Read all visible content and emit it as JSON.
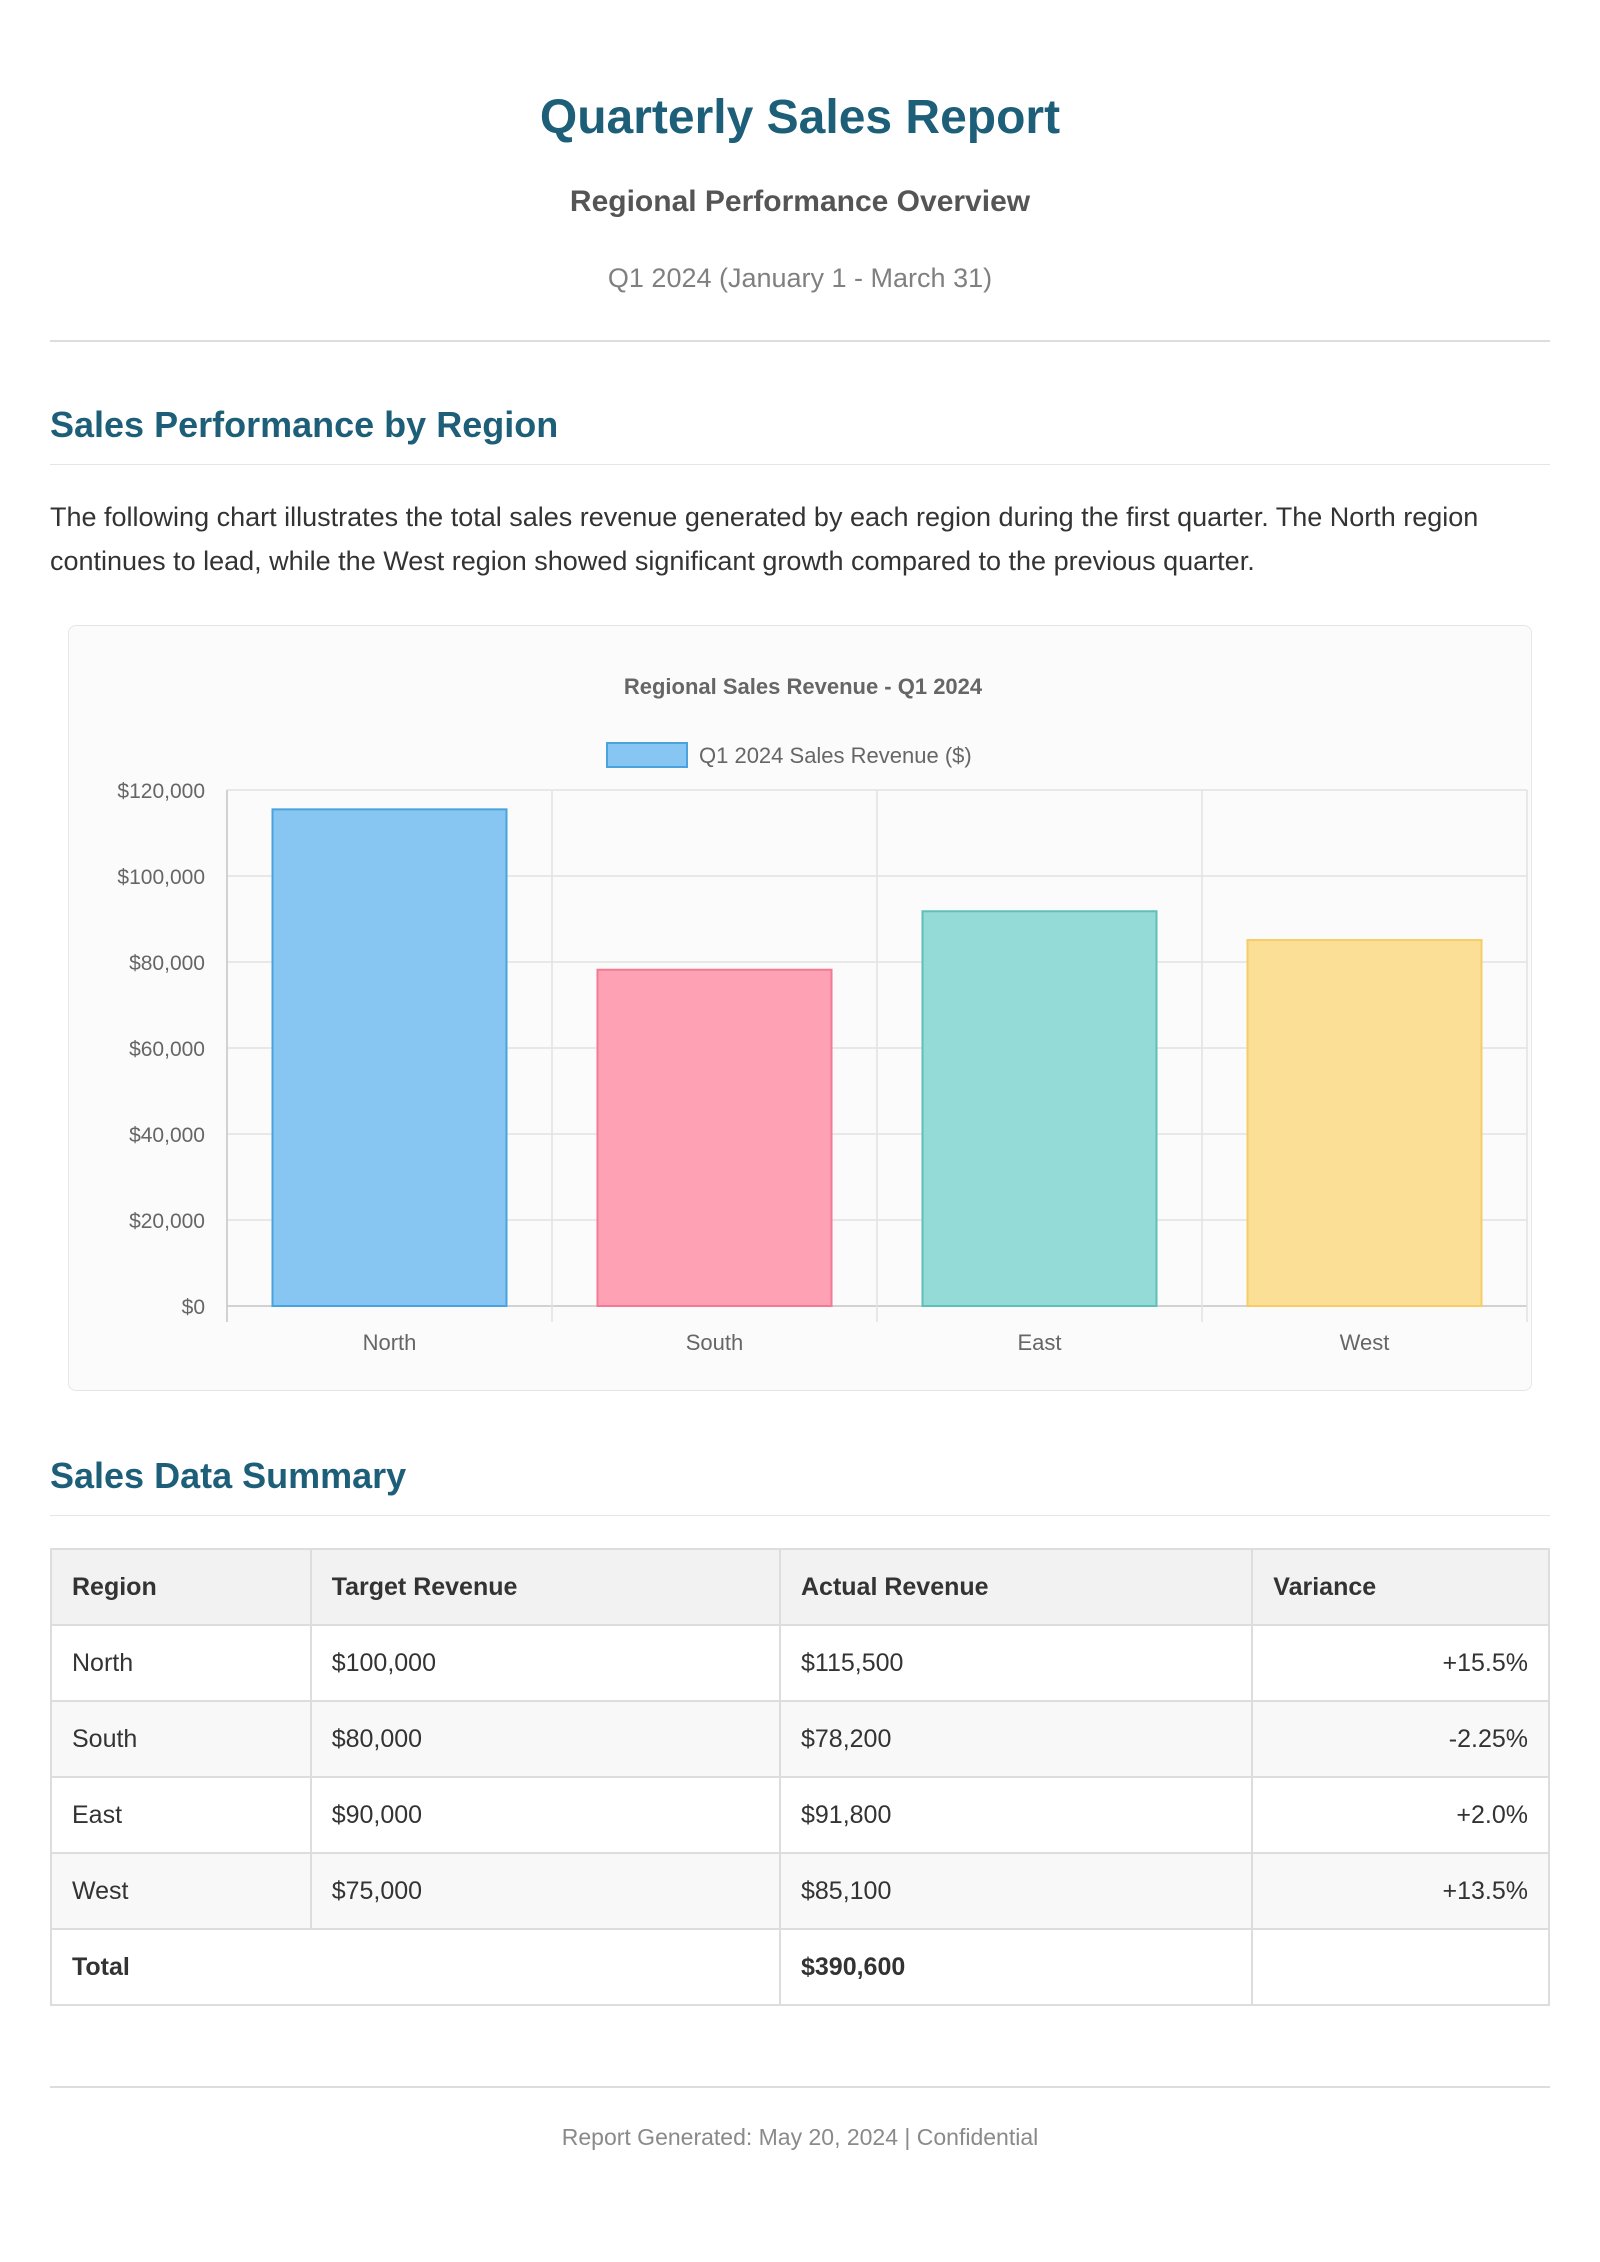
{
  "header": {
    "title": "Quarterly Sales Report",
    "subtitle": "Regional Performance Overview",
    "period": "Q1 2024 (January 1 - March 31)"
  },
  "section1": {
    "heading": "Sales Performance by Region",
    "intro": "The following chart illustrates the total sales revenue generated by each region during the first quarter. The North region continues to lead, while the West region showed significant growth compared to the previous quarter."
  },
  "chart_data": {
    "type": "bar",
    "title": "Regional Sales Revenue - Q1 2024",
    "categories": [
      "North",
      "South",
      "East",
      "West"
    ],
    "series": [
      {
        "name": "Q1 2024 Sales Revenue ($)",
        "values": [
          115500,
          78200,
          91800,
          85100
        ],
        "colors": [
          "#87c5f2",
          "#fea1b4",
          "#94dad6",
          "#fbdf96"
        ],
        "borders": [
          "#4aa3dd",
          "#f27a93",
          "#5fbfbb",
          "#f5cc66"
        ]
      }
    ],
    "ylim": [
      0,
      120000
    ],
    "yticks": [
      0,
      20000,
      40000,
      60000,
      80000,
      100000,
      120000
    ],
    "ytick_labels": [
      "$0",
      "$20,000",
      "$40,000",
      "$60,000",
      "$80,000",
      "$100,000",
      "$120,000"
    ],
    "legend_position": "top",
    "grid": true,
    "xlabel": "",
    "ylabel": ""
  },
  "section2": {
    "heading": "Sales Data Summary"
  },
  "table": {
    "headers": [
      "Region",
      "Target Revenue",
      "Actual Revenue",
      "Variance"
    ],
    "rows": [
      [
        "North",
        "$100,000",
        "$115,500",
        "+15.5%"
      ],
      [
        "South",
        "$80,000",
        "$78,200",
        "-2.25%"
      ],
      [
        "East",
        "$90,000",
        "$91,800",
        "+2.0%"
      ],
      [
        "West",
        "$75,000",
        "$85,100",
        "+13.5%"
      ]
    ],
    "total_label": "Total",
    "total_actual": "$390,600",
    "total_variance": ""
  },
  "footer": {
    "text": "Report Generated: May 20, 2024 | Confidential"
  },
  "colors": {
    "heading": "#1d5f78",
    "border": "#dddddd"
  }
}
